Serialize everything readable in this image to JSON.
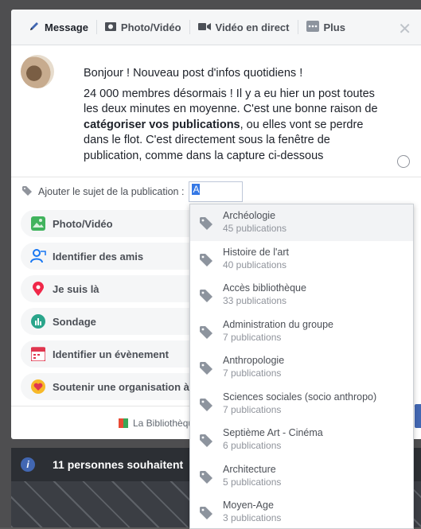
{
  "tabs": [
    {
      "label": "Message",
      "icon": "pencil-icon"
    },
    {
      "label": "Photo/Vidéo",
      "icon": "camera-icon"
    },
    {
      "label": "Vidéo en direct",
      "icon": "video-camera-icon"
    },
    {
      "label": "Plus",
      "icon": "more-icon"
    }
  ],
  "post": {
    "line1": "Bonjour ! Nouveau post d'infos quotidiens !",
    "para2_before": "24 000 membres désormais ! Il y a eu hier un post toutes les deux minutes en moyenne. C'est une bonne raison de ",
    "para2_bold": "catégoriser vos publications",
    "para2_after": ", ou elles vont se perdre dans le flot. C'est directement sous la fenêtre de publication, comme dans la capture ci-dessous"
  },
  "topic": {
    "label": "Ajouter le sujet de la publication :",
    "value": "A"
  },
  "options": [
    {
      "label": "Photo/Vidéo",
      "icon": "photo-icon"
    },
    {
      "label": "Identifier des amis",
      "icon": "tag-friends-icon"
    },
    {
      "label": "Je suis là",
      "icon": "location-pin-icon"
    },
    {
      "label": "Sondage",
      "icon": "poll-icon"
    },
    {
      "label": "Identifier un évènement",
      "icon": "calendar-icon"
    },
    {
      "label": "Soutenir une organisation à b",
      "icon": "heart-support-icon"
    }
  ],
  "footer": {
    "page_label": "La Bibliothèque So"
  },
  "notification": {
    "text": "11 personnes souhaitent"
  },
  "suggestions": [
    {
      "name": "Archéologie",
      "count": "45 publications"
    },
    {
      "name": "Histoire de l'art",
      "count": "40 publications"
    },
    {
      "name": "Accès bibliothèque",
      "count": "33 publications"
    },
    {
      "name": "Administration du groupe",
      "count": "7 publications"
    },
    {
      "name": "Anthropologie",
      "count": "7 publications"
    },
    {
      "name": "Sciences sociales (socio anthropo)",
      "count": "7 publications"
    },
    {
      "name": "Septième Art - Cinéma",
      "count": "6 publications"
    },
    {
      "name": "Architecture",
      "count": "5 publications"
    },
    {
      "name": "Moyen-Age",
      "count": "3 publications"
    }
  ]
}
